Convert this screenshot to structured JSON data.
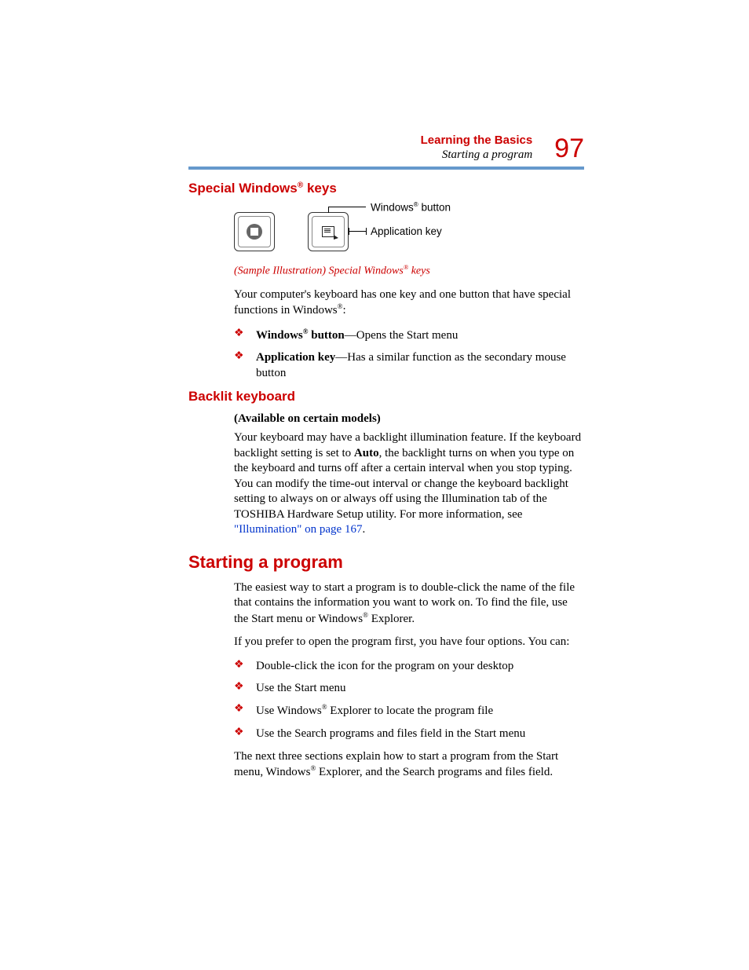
{
  "header": {
    "chapter": "Learning the Basics",
    "section": "Starting a program",
    "page": "97"
  },
  "s1": {
    "title_a": "Special Windows",
    "title_b": " keys",
    "label_win_a": "Windows",
    "label_win_b": " button",
    "label_app": "Application key",
    "caption_a": "(Sample Illustration) Special Windows",
    "caption_b": " keys",
    "p1_a": "Your computer's keyboard has one key and one button that have special functions in Windows",
    "p1_b": ":",
    "b1_strong_a": "Windows",
    "b1_strong_b": " button",
    "b1_rest": "—Opens the Start menu",
    "b2_strong": "Application key",
    "b2_rest": "—Has a similar function as the secondary mouse button"
  },
  "s2": {
    "title": "Backlit keyboard",
    "note": "(Available on certain models)",
    "p_a": "Your keyboard may have a backlight illumination feature. If the keyboard backlight setting is set to ",
    "p_auto": "Auto",
    "p_b": ", the backlight turns on when you type on the keyboard and turns off after a certain interval when you stop typing. You can modify the time-out interval or change the keyboard backlight setting to always on or always off using the Illumination tab of the TOSHIBA Hardware Setup utility. For more information, see ",
    "link": "\"Illumination\" on page 167",
    "p_c": "."
  },
  "s3": {
    "title": "Starting a program",
    "p1_a": "The easiest way to start a program is to double-click the name of the file that contains the information you want to work on. To find the file, use the Start menu or Windows",
    "p1_b": " Explorer.",
    "p2": "If you prefer to open the program first, you have four options. You can:",
    "b1": "Double-click the icon for the program on your desktop",
    "b2": "Use the Start menu",
    "b3_a": "Use Windows",
    "b3_b": " Explorer to locate the program file",
    "b4": "Use the Search programs and files field in the Start menu",
    "p3_a": "The next three sections explain how to start a program from the Start menu, Windows",
    "p3_b": " Explorer, and the Search programs and files field."
  }
}
